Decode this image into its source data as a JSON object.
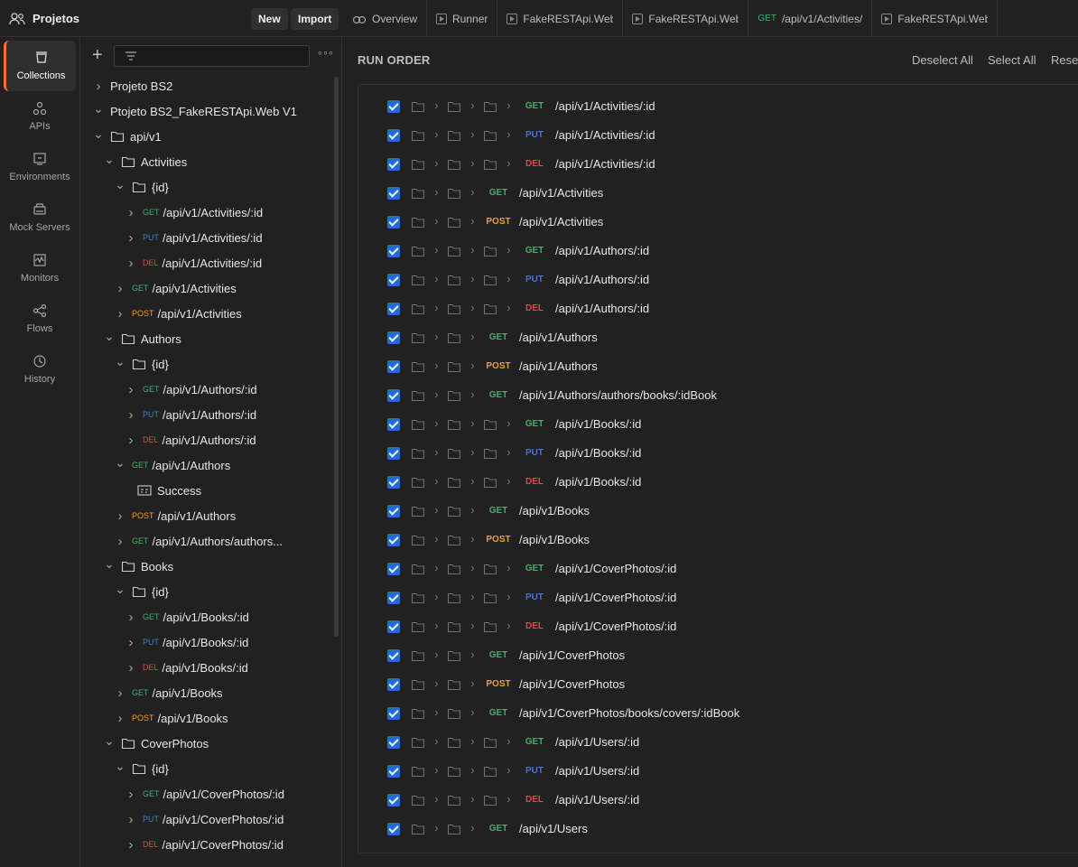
{
  "colors": {
    "get": "#3cb46e",
    "put": "#3d7bd9",
    "post": "#f0a030",
    "del": "#e5483b",
    "accent": "#ff6c37",
    "checkbox": "#1f6ed4"
  },
  "workspace": {
    "title": "Projetos",
    "new_label": "New",
    "import_label": "Import"
  },
  "tabs": [
    {
      "label": "Overview",
      "icon": "overview-icon"
    },
    {
      "label": "Runner",
      "icon": "runner-icon"
    },
    {
      "label": "FakeRESTApi.Web",
      "icon": "runner-icon"
    },
    {
      "label": "FakeRESTApi.Web",
      "icon": "runner-icon"
    },
    {
      "method": "GET",
      "label": "/api/v1/Activities/",
      "icon": ""
    },
    {
      "label": "FakeRESTApi.Web",
      "icon": "runner-icon"
    }
  ],
  "rail": [
    {
      "label": "Collections",
      "icon": "collections-icon",
      "active": true
    },
    {
      "label": "APIs",
      "icon": "apis-icon"
    },
    {
      "label": "Environments",
      "icon": "environments-icon"
    },
    {
      "label": "Mock Servers",
      "icon": "mock-servers-icon"
    },
    {
      "label": "Monitors",
      "icon": "monitors-icon"
    },
    {
      "label": "Flows",
      "icon": "flows-icon"
    },
    {
      "label": "History",
      "icon": "history-icon"
    }
  ],
  "tree": [
    {
      "level": 0,
      "chev": "right",
      "label": "Projeto BS2"
    },
    {
      "level": 0,
      "chev": "down",
      "label": "Ptojeto BS2_FakeRESTApi.Web V1"
    },
    {
      "level": 1,
      "chev": "down",
      "folder": true,
      "label": "api/v1"
    },
    {
      "level": 2,
      "chev": "down",
      "folder": true,
      "label": "Activities"
    },
    {
      "level": 3,
      "chev": "down",
      "folder": true,
      "label": "{id}"
    },
    {
      "level": 4,
      "chev": "right",
      "method": "GET",
      "label": "/api/v1/Activities/:id"
    },
    {
      "level": 4,
      "chev": "right",
      "method": "PUT",
      "label": "/api/v1/Activities/:id"
    },
    {
      "level": 4,
      "chev": "right",
      "method": "DEL",
      "label": "/api/v1/Activities/:id"
    },
    {
      "level": 3,
      "chev": "right",
      "method": "GET",
      "label": "/api/v1/Activities"
    },
    {
      "level": 3,
      "chev": "right",
      "method": "POST",
      "label": "/api/v1/Activities"
    },
    {
      "level": 2,
      "chev": "down",
      "folder": true,
      "label": "Authors"
    },
    {
      "level": 3,
      "chev": "down",
      "folder": true,
      "label": "{id}"
    },
    {
      "level": 4,
      "chev": "right",
      "method": "GET",
      "label": "/api/v1/Authors/:id"
    },
    {
      "level": 4,
      "chev": "right",
      "method": "PUT",
      "label": "/api/v1/Authors/:id"
    },
    {
      "level": 4,
      "chev": "right",
      "method": "DEL",
      "label": "/api/v1/Authors/:id"
    },
    {
      "level": 3,
      "chev": "down",
      "method": "GET",
      "label": "/api/v1/Authors"
    },
    {
      "level": 5,
      "chev": "none",
      "example": true,
      "label": "Success"
    },
    {
      "level": 3,
      "chev": "right",
      "method": "POST",
      "label": "/api/v1/Authors"
    },
    {
      "level": 3,
      "chev": "right",
      "method": "GET",
      "label": "/api/v1/Authors/authors..."
    },
    {
      "level": 2,
      "chev": "down",
      "folder": true,
      "label": "Books"
    },
    {
      "level": 3,
      "chev": "down",
      "folder": true,
      "label": "{id}"
    },
    {
      "level": 4,
      "chev": "right",
      "method": "GET",
      "label": "/api/v1/Books/:id"
    },
    {
      "level": 4,
      "chev": "right",
      "method": "PUT",
      "label": "/api/v1/Books/:id"
    },
    {
      "level": 4,
      "chev": "right",
      "method": "DEL",
      "label": "/api/v1/Books/:id"
    },
    {
      "level": 3,
      "chev": "right",
      "method": "GET",
      "label": "/api/v1/Books"
    },
    {
      "level": 3,
      "chev": "right",
      "method": "POST",
      "label": "/api/v1/Books"
    },
    {
      "level": 2,
      "chev": "down",
      "folder": true,
      "label": "CoverPhotos"
    },
    {
      "level": 3,
      "chev": "down",
      "folder": true,
      "label": "{id}"
    },
    {
      "level": 4,
      "chev": "right",
      "method": "GET",
      "label": "/api/v1/CoverPhotos/:id"
    },
    {
      "level": 4,
      "chev": "right",
      "method": "PUT",
      "label": "/api/v1/CoverPhotos/:id"
    },
    {
      "level": 4,
      "chev": "right",
      "method": "DEL",
      "label": "/api/v1/CoverPhotos/:id"
    }
  ],
  "run_order": {
    "title": "RUN ORDER",
    "deselect_all": "Deselect All",
    "select_all": "Select All",
    "reset": "Reset",
    "items": [
      {
        "depth": 3,
        "method": "GET",
        "path": "/api/v1/Activities/:id"
      },
      {
        "depth": 3,
        "method": "PUT",
        "path": "/api/v1/Activities/:id"
      },
      {
        "depth": 3,
        "method": "DEL",
        "path": "/api/v1/Activities/:id"
      },
      {
        "depth": 2,
        "method": "GET",
        "path": "/api/v1/Activities"
      },
      {
        "depth": 2,
        "method": "POST",
        "path": "/api/v1/Activities"
      },
      {
        "depth": 3,
        "method": "GET",
        "path": "/api/v1/Authors/:id"
      },
      {
        "depth": 3,
        "method": "PUT",
        "path": "/api/v1/Authors/:id"
      },
      {
        "depth": 3,
        "method": "DEL",
        "path": "/api/v1/Authors/:id"
      },
      {
        "depth": 2,
        "method": "GET",
        "path": "/api/v1/Authors"
      },
      {
        "depth": 2,
        "method": "POST",
        "path": "/api/v1/Authors"
      },
      {
        "depth": 2,
        "method": "GET",
        "path": "/api/v1/Authors/authors/books/:idBook"
      },
      {
        "depth": 3,
        "method": "GET",
        "path": "/api/v1/Books/:id"
      },
      {
        "depth": 3,
        "method": "PUT",
        "path": "/api/v1/Books/:id"
      },
      {
        "depth": 3,
        "method": "DEL",
        "path": "/api/v1/Books/:id"
      },
      {
        "depth": 2,
        "method": "GET",
        "path": "/api/v1/Books"
      },
      {
        "depth": 2,
        "method": "POST",
        "path": "/api/v1/Books"
      },
      {
        "depth": 3,
        "method": "GET",
        "path": "/api/v1/CoverPhotos/:id"
      },
      {
        "depth": 3,
        "method": "PUT",
        "path": "/api/v1/CoverPhotos/:id"
      },
      {
        "depth": 3,
        "method": "DEL",
        "path": "/api/v1/CoverPhotos/:id"
      },
      {
        "depth": 2,
        "method": "GET",
        "path": "/api/v1/CoverPhotos"
      },
      {
        "depth": 2,
        "method": "POST",
        "path": "/api/v1/CoverPhotos"
      },
      {
        "depth": 2,
        "method": "GET",
        "path": "/api/v1/CoverPhotos/books/covers/:idBook"
      },
      {
        "depth": 3,
        "method": "GET",
        "path": "/api/v1/Users/:id"
      },
      {
        "depth": 3,
        "method": "PUT",
        "path": "/api/v1/Users/:id"
      },
      {
        "depth": 3,
        "method": "DEL",
        "path": "/api/v1/Users/:id"
      },
      {
        "depth": 2,
        "method": "GET",
        "path": "/api/v1/Users"
      }
    ]
  }
}
